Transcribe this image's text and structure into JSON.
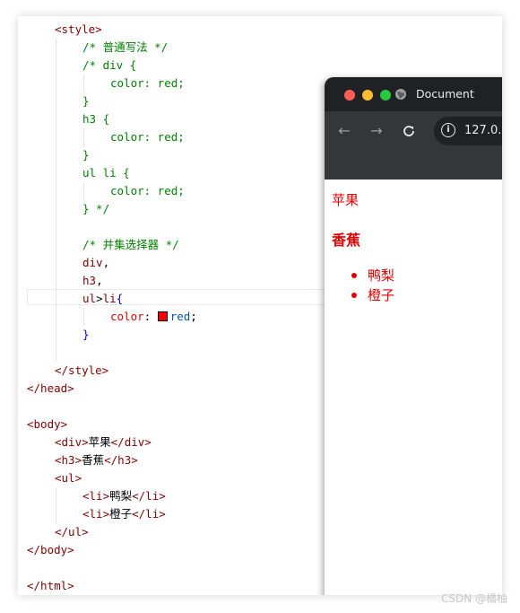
{
  "editor": {
    "lines": [
      {
        "indent": 1,
        "parts": [
          [
            "tag",
            "<style>"
          ]
        ]
      },
      {
        "indent": 2,
        "parts": [
          [
            "cm",
            "/* 普通写法 */"
          ]
        ]
      },
      {
        "indent": 2,
        "parts": [
          [
            "cm",
            "/* div {"
          ]
        ]
      },
      {
        "indent": 3,
        "parts": [
          [
            "cm",
            "color: red;"
          ]
        ]
      },
      {
        "indent": 2,
        "parts": [
          [
            "cm",
            "}"
          ]
        ]
      },
      {
        "indent": 2,
        "parts": [
          [
            "cm",
            "h3 {"
          ]
        ]
      },
      {
        "indent": 3,
        "parts": [
          [
            "cm",
            "color: red;"
          ]
        ]
      },
      {
        "indent": 2,
        "parts": [
          [
            "cm",
            "}"
          ]
        ]
      },
      {
        "indent": 2,
        "parts": [
          [
            "cm",
            "ul li {"
          ]
        ]
      },
      {
        "indent": 3,
        "parts": [
          [
            "cm",
            "color: red;"
          ]
        ]
      },
      {
        "indent": 2,
        "parts": [
          [
            "cm",
            "} */"
          ]
        ]
      },
      {
        "indent": 0,
        "parts": []
      },
      {
        "indent": 2,
        "parts": [
          [
            "cm",
            "/* 并集选择器 */"
          ]
        ]
      },
      {
        "indent": 2,
        "parts": [
          [
            "sel",
            "div"
          ],
          [
            "punct",
            ","
          ]
        ]
      },
      {
        "indent": 2,
        "parts": [
          [
            "sel",
            "h3"
          ],
          [
            "punct",
            ","
          ]
        ]
      },
      {
        "indent": 2,
        "parts": [
          [
            "sel",
            "ul"
          ],
          [
            "punct",
            ">"
          ],
          [
            "sel",
            "li"
          ],
          [
            "brace",
            "{"
          ]
        ]
      },
      {
        "indent": 3,
        "parts": [
          [
            "prop",
            "color"
          ],
          [
            "punct",
            ": "
          ],
          [
            "swatch",
            ""
          ],
          [
            "val",
            "red"
          ],
          [
            "punct",
            ";"
          ]
        ]
      },
      {
        "indent": 2,
        "parts": [
          [
            "brace",
            "}"
          ]
        ]
      },
      {
        "indent": 0,
        "parts": []
      },
      {
        "indent": 1,
        "parts": [
          [
            "tag",
            "</style>"
          ]
        ]
      },
      {
        "indent": 0,
        "parts": [
          [
            "tag",
            "</head>"
          ]
        ]
      },
      {
        "indent": 0,
        "parts": []
      },
      {
        "indent": 0,
        "parts": [
          [
            "tag",
            "<body>"
          ]
        ]
      },
      {
        "indent": 1,
        "parts": [
          [
            "tag",
            "<div>"
          ],
          [
            "txt",
            "苹果"
          ],
          [
            "tag",
            "</div>"
          ]
        ]
      },
      {
        "indent": 1,
        "parts": [
          [
            "tag",
            "<h3>"
          ],
          [
            "txt",
            "香蕉"
          ],
          [
            "tag",
            "</h3>"
          ]
        ]
      },
      {
        "indent": 1,
        "parts": [
          [
            "tag",
            "<ul>"
          ]
        ]
      },
      {
        "indent": 2,
        "parts": [
          [
            "tag",
            "<li>"
          ],
          [
            "txt",
            "鸭梨"
          ],
          [
            "tag",
            "</li>"
          ]
        ]
      },
      {
        "indent": 2,
        "parts": [
          [
            "tag",
            "<li>"
          ],
          [
            "txt",
            "橙子"
          ],
          [
            "tag",
            "</li>"
          ]
        ]
      },
      {
        "indent": 1,
        "parts": [
          [
            "tag",
            "</ul>"
          ]
        ]
      },
      {
        "indent": 0,
        "parts": [
          [
            "tag",
            "</body>"
          ]
        ]
      },
      {
        "indent": 0,
        "parts": []
      },
      {
        "indent": 0,
        "parts": [
          [
            "tag",
            "</html>"
          ]
        ]
      }
    ]
  },
  "browser": {
    "tab_title": "Document",
    "url": "127.0.",
    "traffic_colors": [
      "#ff5f57",
      "#febc2e",
      "#28c840"
    ],
    "page": {
      "div_text": "苹果",
      "h3_text": "香蕉",
      "list_items": [
        "鸭梨",
        "橙子"
      ],
      "text_color": "#e00000"
    }
  },
  "watermark": "CSDN @橘柚"
}
